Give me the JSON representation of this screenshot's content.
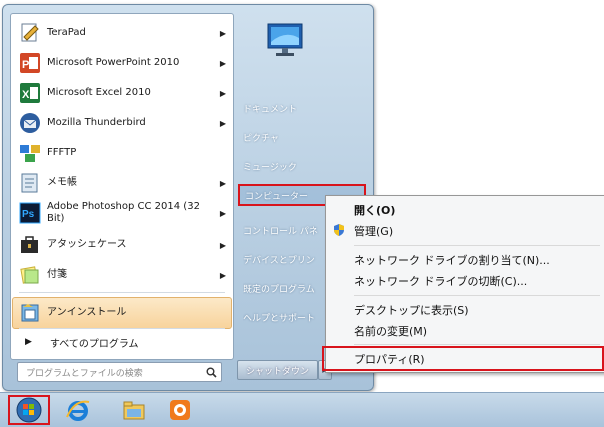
{
  "programs": [
    {
      "label": "TeraPad",
      "icon": "terapad-icon",
      "has_submenu": true
    },
    {
      "label": "Microsoft PowerPoint 2010",
      "icon": "powerpoint-icon",
      "has_submenu": true
    },
    {
      "label": "Microsoft Excel 2010",
      "icon": "excel-icon",
      "has_submenu": true
    },
    {
      "label": "Mozilla Thunderbird",
      "icon": "thunderbird-icon",
      "has_submenu": true
    },
    {
      "label": "FFFTP",
      "icon": "ffftp-icon",
      "has_submenu": false
    },
    {
      "label": "メモ帳",
      "icon": "notepad-icon",
      "has_submenu": true
    },
    {
      "label": "Adobe Photoshop CC 2014 (32 Bit)",
      "icon": "photoshop-icon",
      "has_submenu": true
    },
    {
      "label": "アタッシェケース",
      "icon": "attache-case-icon",
      "has_submenu": true
    },
    {
      "label": "付箋",
      "icon": "sticky-notes-icon",
      "has_submenu": true
    },
    {
      "label": "アンインストール",
      "icon": "uninstall-icon",
      "has_submenu": false
    }
  ],
  "all_programs": "すべてのプログラム",
  "search_placeholder": "プログラムとファイルの検索",
  "right_items": [
    {
      "label": "ドキュメント"
    },
    {
      "label": "ピクチャ"
    },
    {
      "label": "ミュージック"
    },
    {
      "label": "コンピューター"
    },
    {
      "label": "コントロール パネ"
    },
    {
      "label": "デバイスとプリン"
    },
    {
      "label": "既定のプログラム"
    },
    {
      "label": "ヘルプとサポート"
    }
  ],
  "shutdown_label": "シャットダウン",
  "context_menu": {
    "open": "開く(O)",
    "manage": "管理(G)",
    "map_drive": "ネットワーク ドライブの割り当て(N)...",
    "disconnect_drive": "ネットワーク ドライブの切断(C)...",
    "show_on_desktop": "デスクトップに表示(S)",
    "rename": "名前の変更(M)",
    "properties": "プロパティ(R)"
  },
  "colors": {
    "highlight_red": "#d8141c",
    "menu_blue": "#b9cfe2",
    "hover_orange": "#f8d39c"
  }
}
